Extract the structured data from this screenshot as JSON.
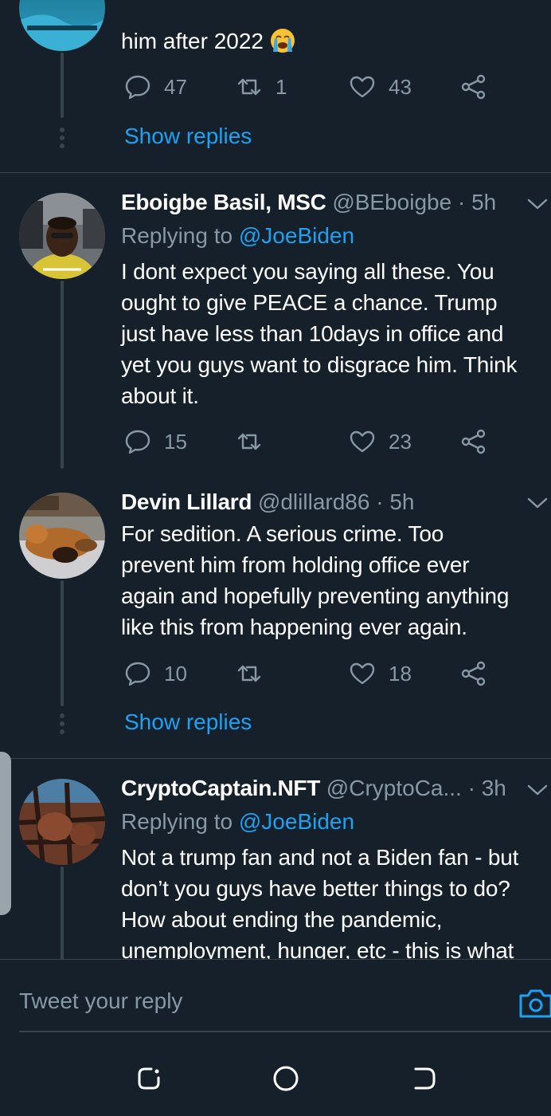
{
  "colors": {
    "background": "#15202b",
    "divider": "#38444d",
    "secondary_text": "#8899a6",
    "accent": "#1da1f2"
  },
  "tweets": [
    {
      "body_tail": "him after 2022",
      "emoji_icon": "loudly-crying-face-icon",
      "actions": {
        "replies": "47",
        "retweets": "1",
        "likes": "43"
      },
      "show_replies": "Show replies"
    },
    {
      "name": "Eboigbe Basil, MSC",
      "handle": "@BEboigbe",
      "separator": "·",
      "time": "5h",
      "replying_prefix": "Replying to",
      "replying_to": "@JoeBiden",
      "text": "I dont expect you saying all these. You\nought to give PEACE a chance. Trump\njust have less than 10days in office and\nyet you guys want to disgrace him. Think\nabout it.",
      "actions": {
        "replies": "15",
        "retweets": "",
        "likes": "23"
      }
    },
    {
      "name": "Devin Lillard",
      "handle": "@dlillard86",
      "separator": "·",
      "time": "5h",
      "text": "For sedition. A serious crime. Too\nprevent him from holding office ever\nagain and hopefully preventing anything\nlike this from happening ever again.",
      "actions": {
        "replies": "10",
        "retweets": "",
        "likes": "18"
      },
      "show_replies": "Show replies"
    },
    {
      "name": "CryptoCaptain.NFT",
      "handle": "@CryptoCa...",
      "separator": "·",
      "time": "3h",
      "replying_prefix": "Replying to",
      "replying_to": "@JoeBiden",
      "text": "Not a trump fan and not a Biden fan - but\ndon’t you guys have better things to do?\nHow about ending the pandemic,\nunemployment, hunger, etc - this is what"
    }
  ],
  "composer": {
    "placeholder": "Tweet your reply",
    "camera_icon": "camera-icon"
  },
  "navbar": {
    "recent_icon": "recent-apps-icon",
    "home_icon": "home-icon",
    "back_icon": "back-icon"
  }
}
